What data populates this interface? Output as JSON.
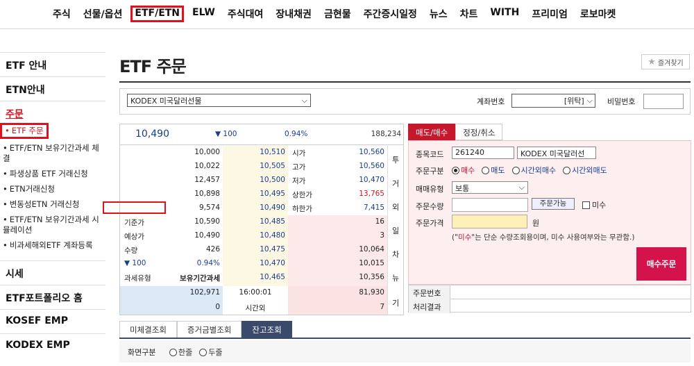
{
  "topnav": [
    "주식",
    "선물/옵션",
    "ETF/ETN",
    "ELW",
    "주식대여",
    "장내채권",
    "금현물",
    "주간증시일정",
    "뉴스",
    "차트",
    "WITH",
    "프리미엄",
    "로보마켓"
  ],
  "sidebar": {
    "etf_guide": "ETF 안내",
    "etn_guide": "ETN안내",
    "order": "주문",
    "subs": [
      "ETF 주문",
      "ETF/ETN 보유기간과세 체결",
      "파생상품 ETF 거래신청",
      "ETN거래신청",
      "변동성ETN 거래신청",
      "ETF/ETN 보유기간과세 시뮬레이션",
      "비과세해외ETF 계좌등록"
    ],
    "quote": "시세",
    "portfolio": "ETF포트폴리오 홈",
    "kosef": "KOSEF EMP",
    "kodex": "KODEX EMP"
  },
  "page": {
    "title": "ETF 주문",
    "favorite": "즐겨찾기"
  },
  "account": {
    "fund": "KODEX 미국달러선물",
    "account_label": "계좌번호",
    "account_type": "[위탁]",
    "password_label": "비밀번호"
  },
  "quote": {
    "price": "10,490",
    "change": "▼ 100",
    "percent": "0.94%",
    "volume": "188,234",
    "asks": [
      {
        "vol": "10,000",
        "price": "10,510"
      },
      {
        "vol": "10,022",
        "price": "10,505"
      },
      {
        "vol": "12,457",
        "price": "10,500"
      },
      {
        "vol": "10,898",
        "price": "10,495"
      },
      {
        "vol": "9,574",
        "price": "10,490"
      }
    ],
    "info": [
      {
        "k": "시가",
        "v": "10,560"
      },
      {
        "k": "고가",
        "v": "10,560"
      },
      {
        "k": "저가",
        "v": "10,470"
      },
      {
        "k": "상한가",
        "v": "13,765"
      },
      {
        "k": "하한가",
        "v": "7,415"
      }
    ],
    "left_info": [
      {
        "k": "기준가",
        "v": "10,590"
      },
      {
        "k": "예상가",
        "v": "10,490"
      },
      {
        "k": "수량",
        "v": "426"
      },
      {
        "k": "▼ 100",
        "v": "0.94%"
      },
      {
        "k": "과세유형",
        "v": "보유기간과세"
      }
    ],
    "bids": [
      {
        "price": "10,485",
        "vol": "16"
      },
      {
        "price": "10,480",
        "vol": "3"
      },
      {
        "price": "10,475",
        "vol": "10,064"
      },
      {
        "price": "10,470",
        "vol": "10,015"
      },
      {
        "price": "10,465",
        "vol": "10,356"
      }
    ],
    "totals": {
      "ask": "102,971",
      "time": "16:00:01",
      "bid": "81,930"
    },
    "after": {
      "ask": "0",
      "label": "시간외",
      "bid": "7"
    },
    "side_labels": [
      "투",
      "거",
      "외",
      "일",
      "차",
      "뉴",
      "기"
    ]
  },
  "order": {
    "tabs": [
      "매도/매수",
      "정정/취소"
    ],
    "code_label": "종목코드",
    "code": "261240",
    "name": "KODEX 미국달러선",
    "type_label": "주문구분",
    "types": [
      "매수",
      "매도",
      "시간외매수",
      "시간외매도"
    ],
    "method_label": "매매유형",
    "method": "보통",
    "qty_label": "주문수량",
    "avail_button": "주문가능",
    "market_check": "미수",
    "price_label": "주문가격",
    "price_unit": "원",
    "note_pre": "(\"",
    "note_hl": "미수",
    "note_post": "\"는 단순 수량조회용이며, 미수 사용여부와는 무관함.)",
    "buy_button": "매수주문",
    "order_no_label": "주문번호",
    "result_label": "처리결과"
  },
  "bottom": {
    "tabs": [
      "미체결조회",
      "증거금별조회",
      "잔고조회"
    ],
    "screen_label": "화면구분",
    "options": [
      "한줄",
      "두줄"
    ]
  }
}
